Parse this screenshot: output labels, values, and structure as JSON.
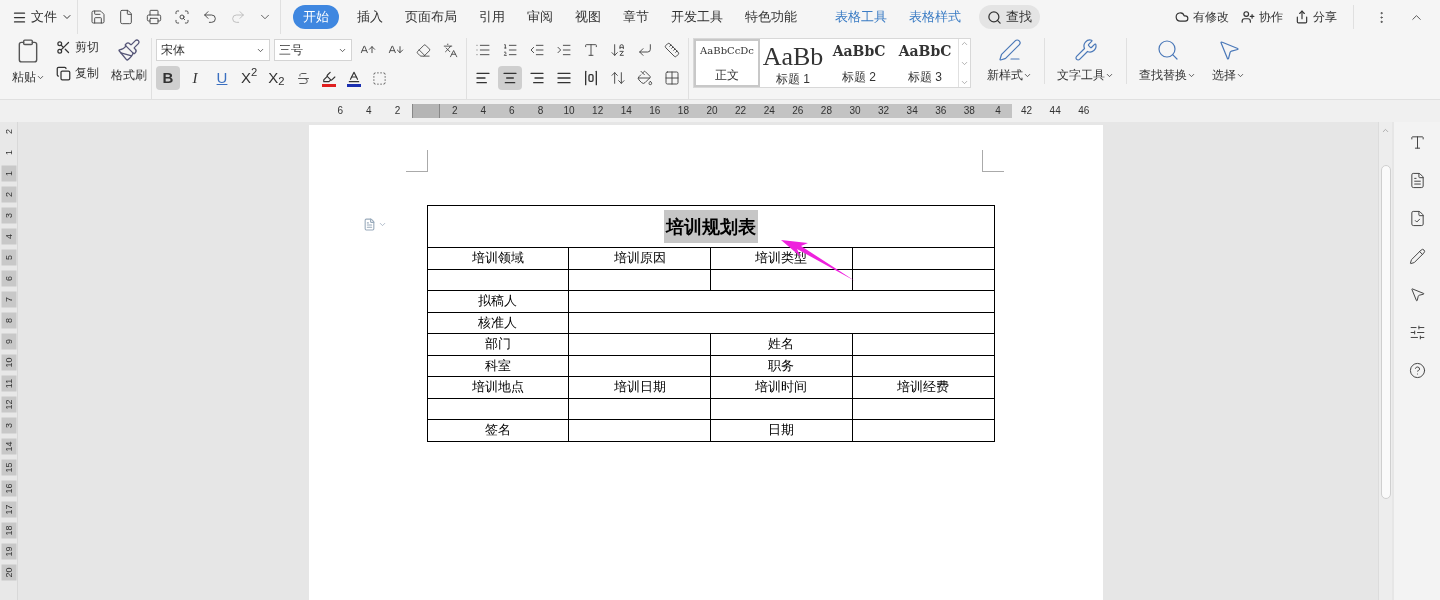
{
  "menu": {
    "label": "文件"
  },
  "tabs": [
    {
      "label": "开始",
      "selected": true,
      "kind": "main"
    },
    {
      "label": "插入",
      "selected": false,
      "kind": "main"
    },
    {
      "label": "页面布局",
      "selected": false,
      "kind": "main"
    },
    {
      "label": "引用",
      "selected": false,
      "kind": "main"
    },
    {
      "label": "审阅",
      "selected": false,
      "kind": "main"
    },
    {
      "label": "视图",
      "selected": false,
      "kind": "main"
    },
    {
      "label": "章节",
      "selected": false,
      "kind": "main"
    },
    {
      "label": "开发工具",
      "selected": false,
      "kind": "main"
    },
    {
      "label": "特色功能",
      "selected": false,
      "kind": "main"
    },
    {
      "label": "表格工具",
      "selected": false,
      "kind": "context"
    },
    {
      "label": "表格样式",
      "selected": false,
      "kind": "context"
    }
  ],
  "search": {
    "label": "查找"
  },
  "header_actions": [
    {
      "label": "有修改",
      "kind": "cloud"
    },
    {
      "label": "协作",
      "kind": "people"
    },
    {
      "label": "分享",
      "kind": "share"
    }
  ],
  "clipboard": {
    "paste": "粘贴",
    "cut": "剪切",
    "copy": "复制",
    "painter": "格式刷"
  },
  "font": {
    "name": "宋体",
    "size": "三号"
  },
  "format_buttons": [
    {
      "label": "B",
      "pressed": true,
      "kind": "bold"
    },
    {
      "label": "I",
      "pressed": false,
      "kind": "italic"
    },
    {
      "label": "U",
      "pressed": false,
      "kind": "underline"
    },
    {
      "label": "X$^{2}$",
      "pressed": false,
      "kind": "plain"
    },
    {
      "label": "X$_{2}$",
      "pressed": false,
      "kind": "plain"
    }
  ],
  "color_buttons": [
    {
      "kind": "highlight",
      "color": "#e02020"
    },
    {
      "kind": "font",
      "color": "#1a2fb0"
    }
  ],
  "alignment": [
    {
      "kind": "left",
      "selected": false
    },
    {
      "kind": "center",
      "selected": true
    },
    {
      "kind": "right",
      "selected": false
    },
    {
      "kind": "justify",
      "selected": false
    },
    {
      "kind": "distributed",
      "selected": false
    }
  ],
  "styles": [
    {
      "preview": "AaBbCcDc",
      "label": "正文",
      "selected": true,
      "kind": "body"
    },
    {
      "preview": "AaBb",
      "label": "标题 1",
      "selected": false,
      "kind": "h1"
    },
    {
      "preview": "AaBbC",
      "label": "标题 2",
      "selected": false,
      "kind": "h2"
    },
    {
      "preview": "AaBbC",
      "label": "标题 3",
      "selected": false,
      "kind": "h3"
    }
  ],
  "big_tools": [
    {
      "label": "新样式",
      "kind": "newstyle"
    },
    {
      "label": "文字工具",
      "kind": "wrench"
    },
    {
      "label": "查找替换",
      "kind": "find"
    },
    {
      "label": "选择",
      "kind": "select"
    }
  ],
  "ruler": {
    "horizontal": [
      "6",
      "4",
      "2",
      "2",
      "4",
      "6",
      "8",
      "10",
      "12",
      "14",
      "16",
      "18",
      "20",
      "22",
      "24",
      "26",
      "28",
      "30",
      "32",
      "34",
      "36",
      "38",
      "4",
      "42",
      "44",
      "46"
    ],
    "vertical": [
      "2",
      "1",
      "1",
      "2",
      "3",
      "4",
      "5",
      "6",
      "7",
      "8",
      "9",
      "10",
      "11",
      "12",
      "3",
      "14",
      "15",
      "16",
      "17",
      "18",
      "19",
      "20"
    ]
  },
  "table": {
    "title": "培训规划表",
    "title_selected": true,
    "rows": [
      {
        "cells": [
          {
            "kind": "text",
            "text": "培训领域"
          },
          {
            "kind": "text",
            "text": "培训原因"
          },
          {
            "kind": "text",
            "text": "培训类型"
          },
          {
            "kind": "blank"
          }
        ]
      },
      {
        "cells": [
          {
            "kind": "blank"
          },
          {
            "kind": "blank"
          },
          {
            "kind": "blank"
          },
          {
            "kind": "blank"
          }
        ]
      },
      {
        "cells": [
          {
            "kind": "text",
            "text": "拟稿人"
          },
          {
            "kind": "merged_blank"
          }
        ]
      },
      {
        "cells": [
          {
            "kind": "text",
            "text": "核准人"
          },
          {
            "kind": "merged_blank"
          }
        ]
      },
      {
        "cells": [
          {
            "kind": "text",
            "text": "部门"
          },
          {
            "kind": "blank"
          },
          {
            "kind": "text",
            "text": "姓名"
          },
          {
            "kind": "blank"
          }
        ]
      },
      {
        "cells": [
          {
            "kind": "text",
            "text": "科室"
          },
          {
            "kind": "blank"
          },
          {
            "kind": "text",
            "text": "职务"
          },
          {
            "kind": "blank"
          }
        ]
      },
      {
        "cells": [
          {
            "kind": "text",
            "text": "培训地点"
          },
          {
            "kind": "text",
            "text": "培训日期"
          },
          {
            "kind": "text",
            "text": "培训时间"
          },
          {
            "kind": "text",
            "text": "培训经费"
          }
        ]
      },
      {
        "cells": [
          {
            "kind": "blank"
          },
          {
            "kind": "blank"
          },
          {
            "kind": "blank"
          },
          {
            "kind": "blank"
          }
        ]
      },
      {
        "cells": [
          {
            "kind": "text",
            "text": "签名"
          },
          {
            "kind": "blank"
          },
          {
            "kind": "text",
            "text": "日期"
          },
          {
            "kind": "blank"
          }
        ]
      }
    ]
  }
}
